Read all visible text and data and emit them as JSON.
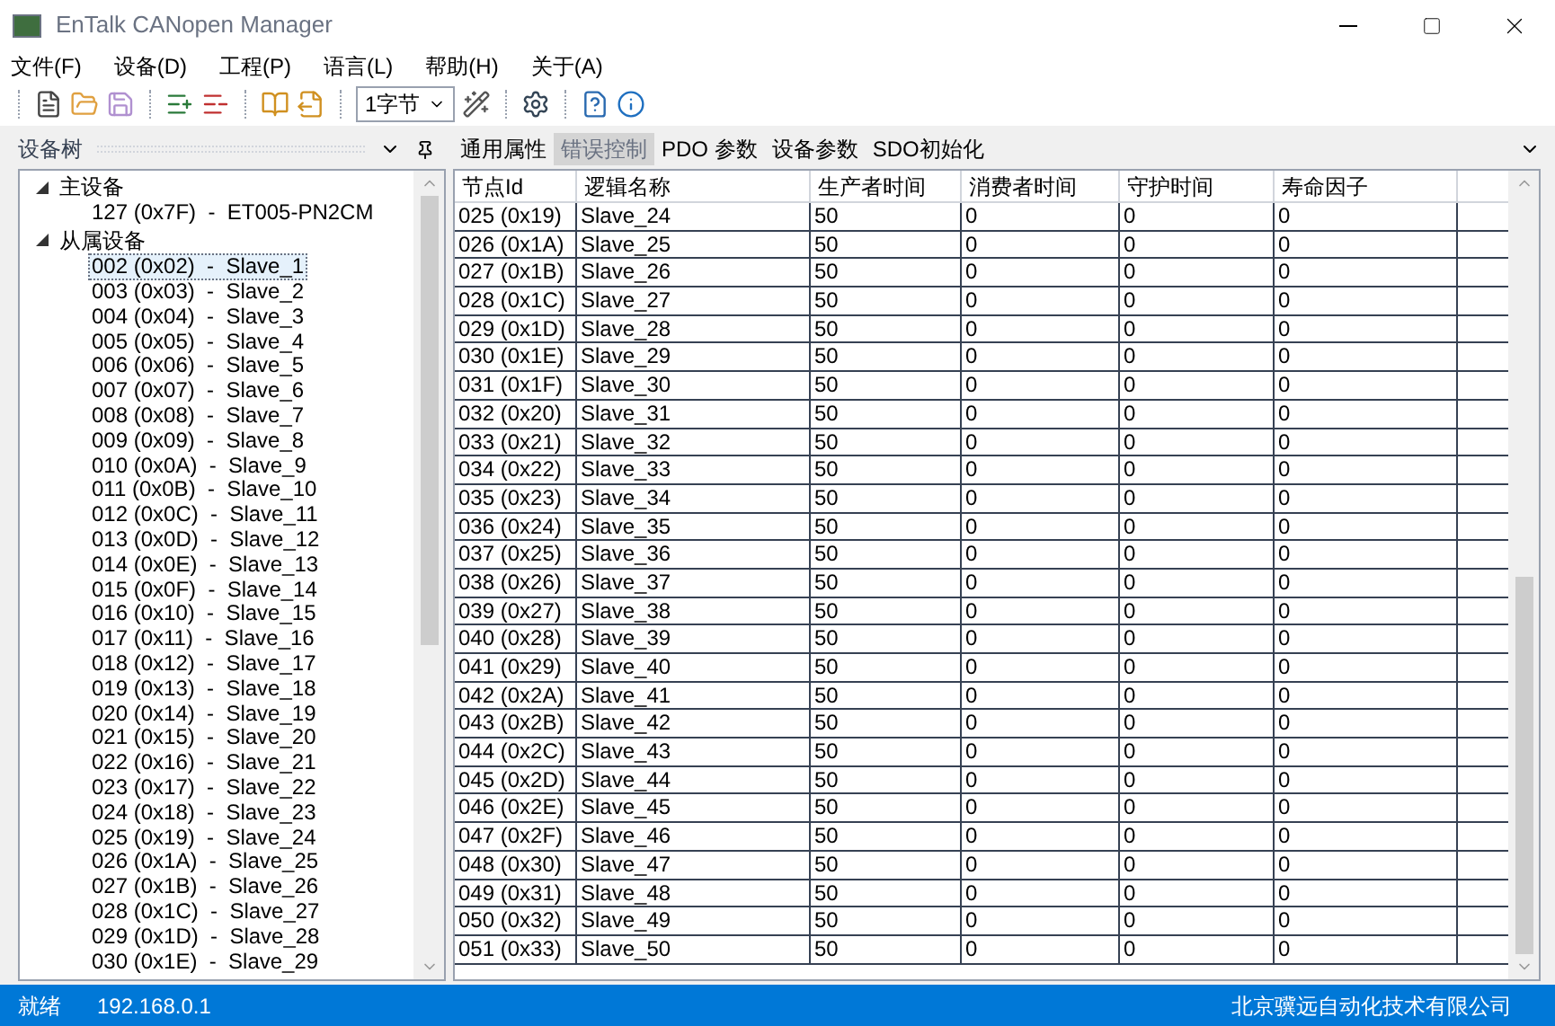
{
  "window": {
    "title": "EnTalk CANopen Manager"
  },
  "menu": [
    "文件(F)",
    "设备(D)",
    "工程(P)",
    "语言(L)",
    "帮助(H)",
    "关于(A)"
  ],
  "toolbar": {
    "combo": "1字节"
  },
  "device_tree": {
    "title": "设备树",
    "items": [
      {
        "label": "主设备",
        "expanded": true,
        "children": [
          {
            "label": "127 (0x7F)  -  ET005-PN2CM",
            "selected": false
          }
        ]
      },
      {
        "label": "从属设备",
        "expanded": true,
        "children": [
          {
            "label": "002 (0x02)  -  Slave_1",
            "selected": true
          },
          {
            "label": "003 (0x03)  -  Slave_2",
            "selected": false
          },
          {
            "label": "004 (0x04)  -  Slave_3",
            "selected": false
          },
          {
            "label": "005 (0x05)  -  Slave_4",
            "selected": false
          },
          {
            "label": "006 (0x06)  -  Slave_5",
            "selected": false
          },
          {
            "label": "007 (0x07)  -  Slave_6",
            "selected": false
          },
          {
            "label": "008 (0x08)  -  Slave_7",
            "selected": false
          },
          {
            "label": "009 (0x09)  -  Slave_8",
            "selected": false
          },
          {
            "label": "010 (0x0A)  -  Slave_9",
            "selected": false
          },
          {
            "label": "011 (0x0B)  -  Slave_10",
            "selected": false
          },
          {
            "label": "012 (0x0C)  -  Slave_11",
            "selected": false
          },
          {
            "label": "013 (0x0D)  -  Slave_12",
            "selected": false
          },
          {
            "label": "014 (0x0E)  -  Slave_13",
            "selected": false
          },
          {
            "label": "015 (0x0F)  -  Slave_14",
            "selected": false
          },
          {
            "label": "016 (0x10)  -  Slave_15",
            "selected": false
          },
          {
            "label": "017 (0x11)  -  Slave_16",
            "selected": false
          },
          {
            "label": "018 (0x12)  -  Slave_17",
            "selected": false
          },
          {
            "label": "019 (0x13)  -  Slave_18",
            "selected": false
          },
          {
            "label": "020 (0x14)  -  Slave_19",
            "selected": false
          },
          {
            "label": "021 (0x15)  -  Slave_20",
            "selected": false
          },
          {
            "label": "022 (0x16)  -  Slave_21",
            "selected": false
          },
          {
            "label": "023 (0x17)  -  Slave_22",
            "selected": false
          },
          {
            "label": "024 (0x18)  -  Slave_23",
            "selected": false
          },
          {
            "label": "025 (0x19)  -  Slave_24",
            "selected": false
          },
          {
            "label": "026 (0x1A)  -  Slave_25",
            "selected": false
          },
          {
            "label": "027 (0x1B)  -  Slave_26",
            "selected": false
          },
          {
            "label": "028 (0x1C)  -  Slave_27",
            "selected": false
          },
          {
            "label": "029 (0x1D)  -  Slave_28",
            "selected": false
          },
          {
            "label": "030 (0x1E)  -  Slave_29",
            "selected": false
          }
        ]
      }
    ]
  },
  "tabs": [
    {
      "label": "通用属性",
      "selected": false
    },
    {
      "label": "错误控制",
      "selected": true
    },
    {
      "label": "PDO 参数",
      "selected": false
    },
    {
      "label": "设备参数",
      "selected": false
    },
    {
      "label": "SDO初始化",
      "selected": false
    }
  ],
  "table": {
    "columns": [
      "节点Id",
      "逻辑名称",
      "生产者时间",
      "消费者时间",
      "守护时间",
      "寿命因子"
    ],
    "rows": [
      [
        "025 (0x19)",
        "Slave_24",
        "50",
        "0",
        "0",
        "0"
      ],
      [
        "026 (0x1A)",
        "Slave_25",
        "50",
        "0",
        "0",
        "0"
      ],
      [
        "027 (0x1B)",
        "Slave_26",
        "50",
        "0",
        "0",
        "0"
      ],
      [
        "028 (0x1C)",
        "Slave_27",
        "50",
        "0",
        "0",
        "0"
      ],
      [
        "029 (0x1D)",
        "Slave_28",
        "50",
        "0",
        "0",
        "0"
      ],
      [
        "030 (0x1E)",
        "Slave_29",
        "50",
        "0",
        "0",
        "0"
      ],
      [
        "031 (0x1F)",
        "Slave_30",
        "50",
        "0",
        "0",
        "0"
      ],
      [
        "032 (0x20)",
        "Slave_31",
        "50",
        "0",
        "0",
        "0"
      ],
      [
        "033 (0x21)",
        "Slave_32",
        "50",
        "0",
        "0",
        "0"
      ],
      [
        "034 (0x22)",
        "Slave_33",
        "50",
        "0",
        "0",
        "0"
      ],
      [
        "035 (0x23)",
        "Slave_34",
        "50",
        "0",
        "0",
        "0"
      ],
      [
        "036 (0x24)",
        "Slave_35",
        "50",
        "0",
        "0",
        "0"
      ],
      [
        "037 (0x25)",
        "Slave_36",
        "50",
        "0",
        "0",
        "0"
      ],
      [
        "038 (0x26)",
        "Slave_37",
        "50",
        "0",
        "0",
        "0"
      ],
      [
        "039 (0x27)",
        "Slave_38",
        "50",
        "0",
        "0",
        "0"
      ],
      [
        "040 (0x28)",
        "Slave_39",
        "50",
        "0",
        "0",
        "0"
      ],
      [
        "041 (0x29)",
        "Slave_40",
        "50",
        "0",
        "0",
        "0"
      ],
      [
        "042 (0x2A)",
        "Slave_41",
        "50",
        "0",
        "0",
        "0"
      ],
      [
        "043 (0x2B)",
        "Slave_42",
        "50",
        "0",
        "0",
        "0"
      ],
      [
        "044 (0x2C)",
        "Slave_43",
        "50",
        "0",
        "0",
        "0"
      ],
      [
        "045 (0x2D)",
        "Slave_44",
        "50",
        "0",
        "0",
        "0"
      ],
      [
        "046 (0x2E)",
        "Slave_45",
        "50",
        "0",
        "0",
        "0"
      ],
      [
        "047 (0x2F)",
        "Slave_46",
        "50",
        "0",
        "0",
        "0"
      ],
      [
        "048 (0x30)",
        "Slave_47",
        "50",
        "0",
        "0",
        "0"
      ],
      [
        "049 (0x31)",
        "Slave_48",
        "50",
        "0",
        "0",
        "0"
      ],
      [
        "050 (0x32)",
        "Slave_49",
        "50",
        "0",
        "0",
        "0"
      ],
      [
        "051 (0x33)",
        "Slave_50",
        "50",
        "0",
        "0",
        "0"
      ]
    ]
  },
  "status_bar": {
    "state": "就绪",
    "address": "192.168.0.1",
    "company": "北京骥远自动化技术有限公司"
  }
}
